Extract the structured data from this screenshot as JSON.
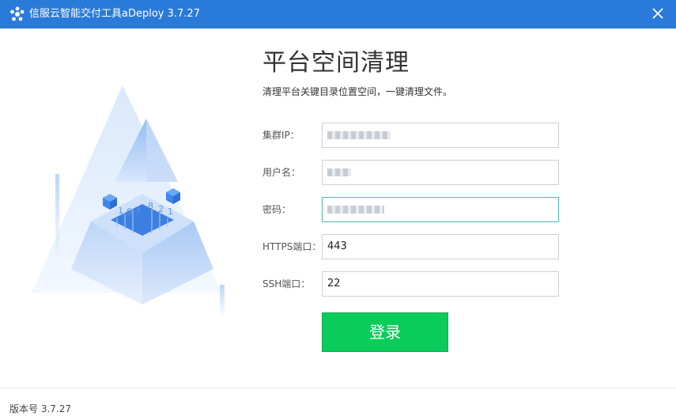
{
  "window": {
    "title": "信服云智能交付工具aDeploy 3.7.27",
    "logo_icon": "asterisk-logo-icon",
    "close_icon": "close-icon"
  },
  "main": {
    "heading": "平台空间清理",
    "subheading": "清理平台关键目录位置空间，一键清理文件。"
  },
  "form": {
    "cluster_ip": {
      "label": "集群IP：",
      "value": ""
    },
    "username": {
      "label": "用户名：",
      "value": ""
    },
    "password": {
      "label": "密码：",
      "value": ""
    },
    "https_port": {
      "label": "HTTPS端口：",
      "value": "443"
    },
    "ssh_port": {
      "label": "SSH端口：",
      "value": "22"
    },
    "submit_label": "登录"
  },
  "footer": {
    "version": "版本号 3.7.27"
  },
  "illustration": {
    "digits": [
      "1",
      "6",
      "3",
      "8",
      "2",
      "1"
    ]
  },
  "colors": {
    "titlebar": "#2a7ad9",
    "button": "#0acc5b",
    "focus_border": "#4fb8b8"
  }
}
